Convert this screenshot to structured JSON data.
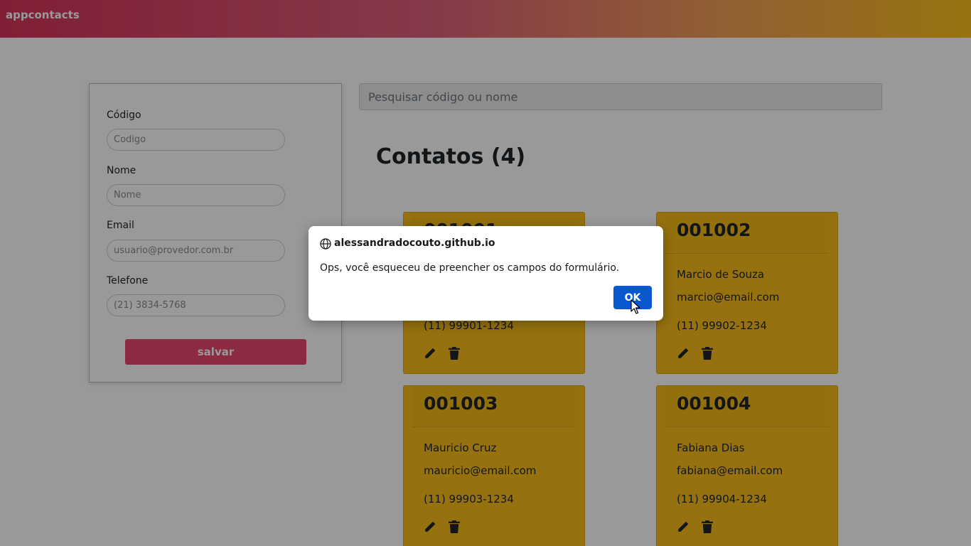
{
  "navbar": {
    "brand": "appcontacts"
  },
  "form": {
    "codigo_label": "Código",
    "codigo_placeholder": "Codigo",
    "nome_label": "Nome",
    "nome_placeholder": "Nome",
    "email_label": "Email",
    "email_placeholder": "usuario@provedor.com.br",
    "telefone_label": "Telefone",
    "telefone_placeholder": "(21) 3834-5768",
    "save_label": "salvar"
  },
  "search": {
    "placeholder": "Pesquisar código ou nome"
  },
  "list": {
    "title": "Contatos (4)"
  },
  "contacts": [
    {
      "code": "001001",
      "name": "",
      "email": "",
      "phone": "(11) 99901-1234"
    },
    {
      "code": "001002",
      "name": "Marcio de Souza",
      "email": "marcio@email.com",
      "phone": "(11) 99902-1234"
    },
    {
      "code": "001003",
      "name": "Mauricio Cruz",
      "email": "mauricio@email.com",
      "phone": "(11) 99903-1234"
    },
    {
      "code": "001004",
      "name": "Fabiana Dias",
      "email": "fabiana@email.com",
      "phone": "(11) 99904-1234"
    }
  ],
  "dialog": {
    "origin": "alessandradocouto.github.io",
    "message": "Ops, você esqueceu de preencher os campos do formulário.",
    "ok_label": "OK"
  },
  "colors": {
    "card": "#f9bf1a",
    "save_button": "#e8476b",
    "ok_button": "#0b57d0"
  },
  "icons": [
    "pencil-icon",
    "trash-icon",
    "globe-icon",
    "cursor-icon"
  ]
}
